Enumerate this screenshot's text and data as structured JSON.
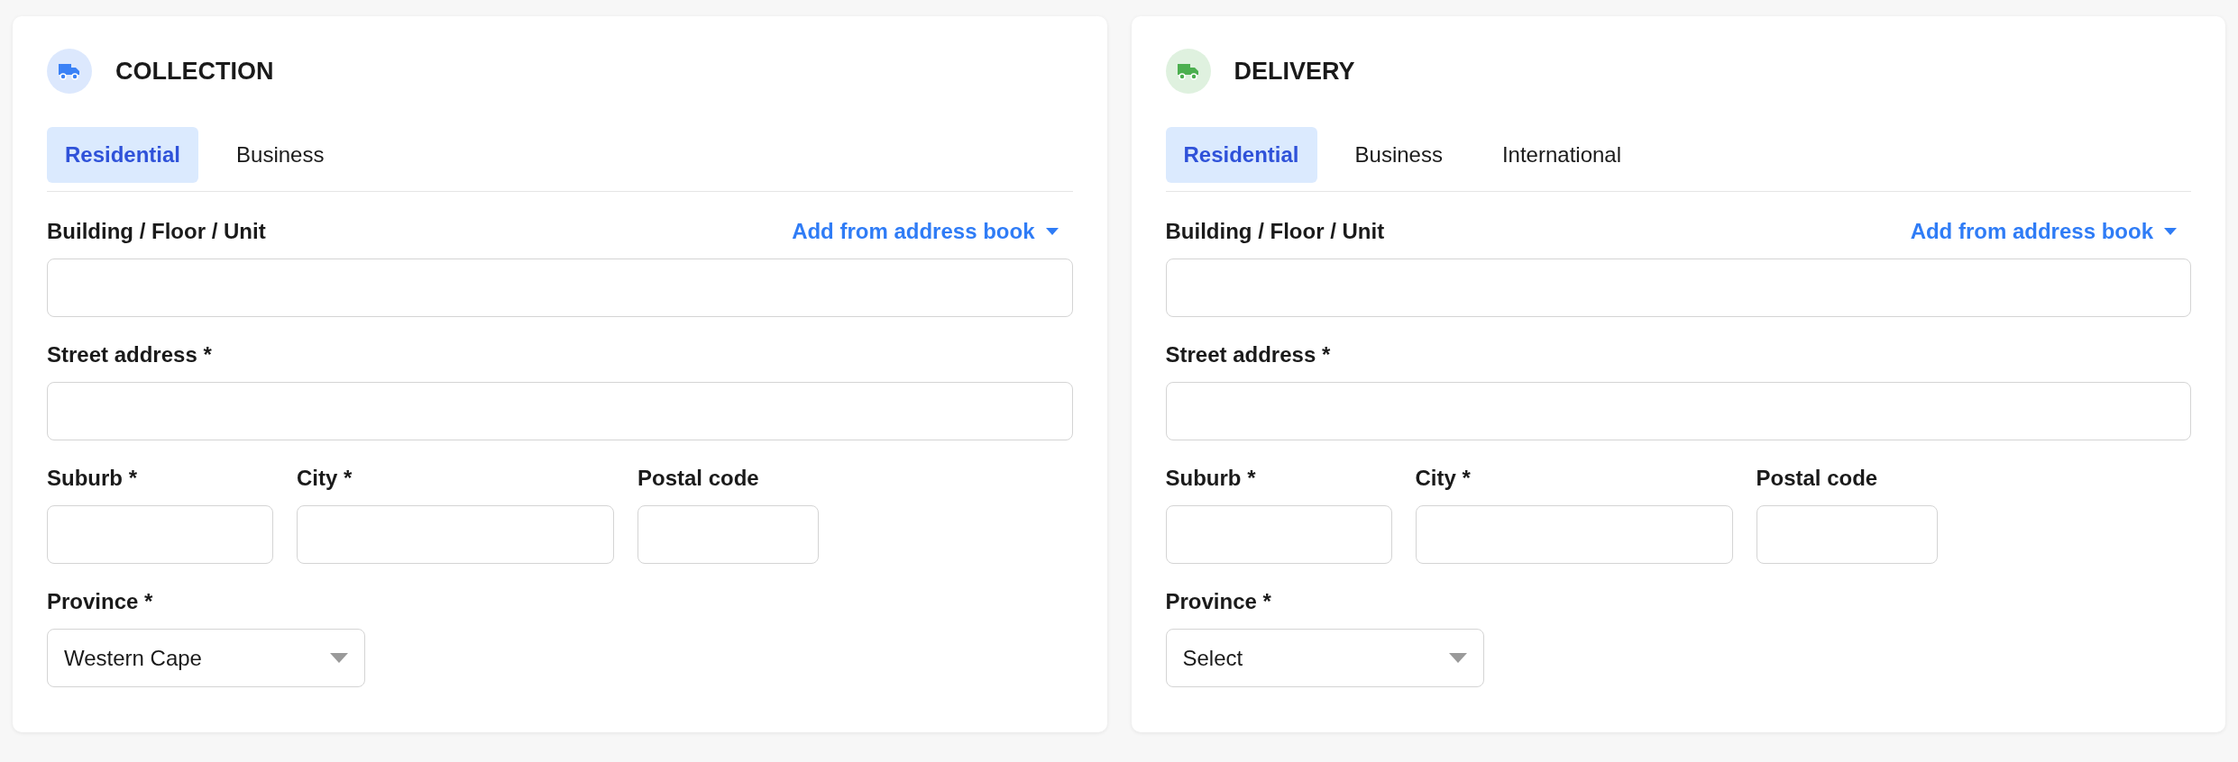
{
  "cards": [
    {
      "title": "COLLECTION",
      "color": "#3b82f6",
      "tabs": [
        {
          "label": "Residential",
          "selected": true
        },
        {
          "label": "Business",
          "selected": false
        }
      ],
      "rows": [
        [
          {
            "label": "Building / Floor / Unit",
            "kind": "input",
            "action": "Add from address book"
          }
        ],
        [
          {
            "label": "Street address *",
            "kind": "input"
          }
        ],
        [
          {
            "label": "Suburb *",
            "kind": "input"
          },
          {
            "label": "City *",
            "kind": "input"
          },
          {
            "label": "Postal code",
            "kind": "input"
          }
        ],
        [
          {
            "label": "Province *",
            "kind": "select",
            "value": "Western Cape"
          }
        ]
      ]
    },
    {
      "title": "DELIVERY",
      "color": "#4caf50",
      "tabs": [
        {
          "label": "Residential",
          "selected": true
        },
        {
          "label": "Business",
          "selected": false
        },
        {
          "label": "International",
          "selected": false
        }
      ],
      "rows": [
        [
          {
            "label": "Building / Floor / Unit",
            "kind": "input",
            "action": "Add from address book"
          }
        ],
        [
          {
            "label": "Street address *",
            "kind": "input"
          }
        ],
        [
          {
            "label": "Suburb *",
            "kind": "input"
          },
          {
            "label": "City *",
            "kind": "input"
          },
          {
            "label": "Postal code",
            "kind": "input"
          }
        ],
        [
          {
            "label": "Province *",
            "kind": "select",
            "value": "Select"
          }
        ]
      ]
    }
  ]
}
